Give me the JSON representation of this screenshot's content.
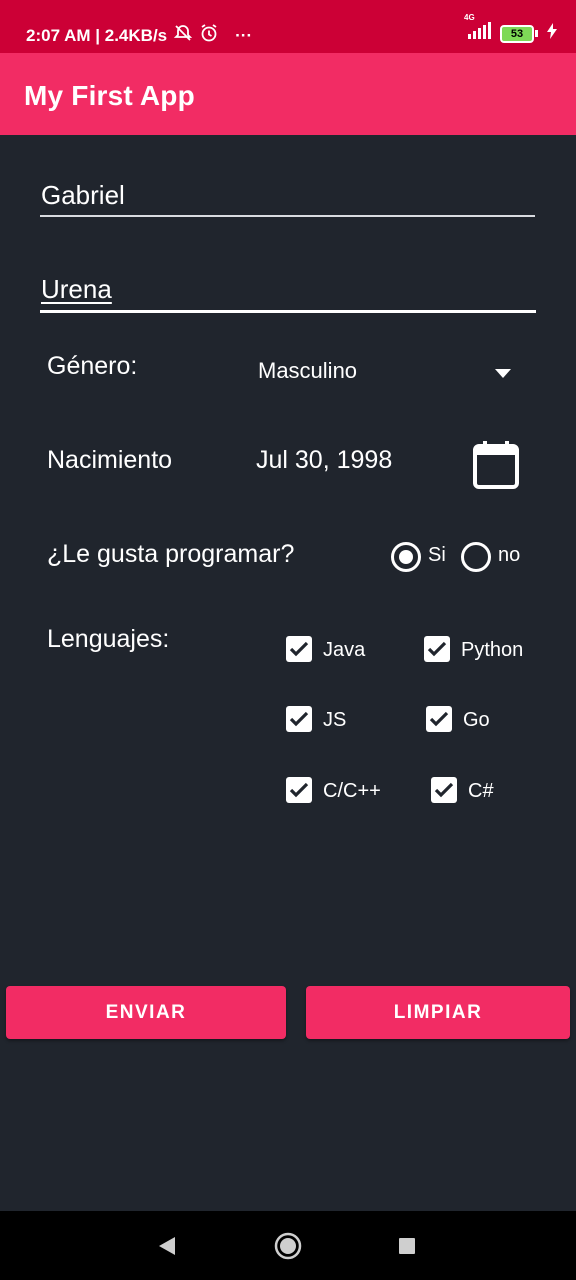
{
  "status_bar": {
    "time_speed": "2:07 AM | 2.4KB/s",
    "more": "···",
    "network": "4G",
    "battery": "53"
  },
  "app_bar": {
    "title": "My First App"
  },
  "form": {
    "first_name": "Gabriel",
    "last_name": "Urena",
    "gender_label": "Género:",
    "gender_value": "Masculino",
    "birth_label": "Nacimiento",
    "birth_value": "Jul 30, 1998",
    "likes_label": "¿Le gusta programar?",
    "radio_yes": "Si",
    "radio_no": "no",
    "radio_selected": "Si",
    "languages_label": "Lenguajes:",
    "languages": [
      {
        "label": "Java",
        "checked": true
      },
      {
        "label": "Python",
        "checked": true
      },
      {
        "label": "JS",
        "checked": true
      },
      {
        "label": "Go",
        "checked": true
      },
      {
        "label": "C/C++",
        "checked": true
      },
      {
        "label": "C#",
        "checked": true
      }
    ]
  },
  "buttons": {
    "send": "ENVIAR",
    "clear": "LIMPIAR"
  },
  "colors": {
    "accent": "#f22c64",
    "status_bar": "#cc0036",
    "background": "#20252d"
  }
}
